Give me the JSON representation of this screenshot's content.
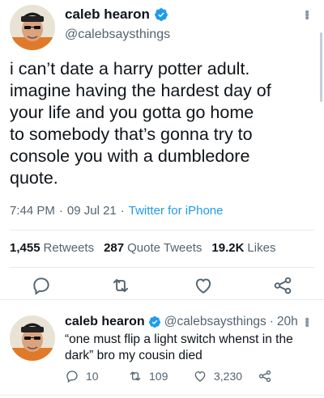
{
  "main_tweet": {
    "author_name": "caleb hearon",
    "author_handle": "@calebsaysthings",
    "text": "i can’t date a harry potter adult.\nimagine having the hardest day of\nyour life and you gotta go home\nto somebody that’s gonna try to\nconsole you with a dumbledore\nquote.",
    "time": "7:44 PM",
    "date": "09 Jul 21",
    "source": "Twitter for iPhone",
    "retweets_count": "1,455",
    "retweets_label": "Retweets",
    "quote_count": "287",
    "quote_label": "Quote Tweets",
    "likes_count": "19.2K",
    "likes_label": "Likes"
  },
  "reply_tweet": {
    "author_name": "caleb hearon",
    "author_handle": "@calebsaysthings",
    "age": "20h",
    "text": "“one must flip a light switch whenst in the\ndark” bro my cousin died",
    "reply_count": "10",
    "retweet_count": "109",
    "like_count": "3,230"
  },
  "icons": {
    "verified": "verified-badge-icon",
    "more": "more-vertical-icon",
    "reply": "reply-icon",
    "retweet": "retweet-icon",
    "like": "heart-icon",
    "share": "share-icon"
  },
  "colors": {
    "accent": "#1d9bf0",
    "text": "#0f1419",
    "muted": "#536471"
  }
}
